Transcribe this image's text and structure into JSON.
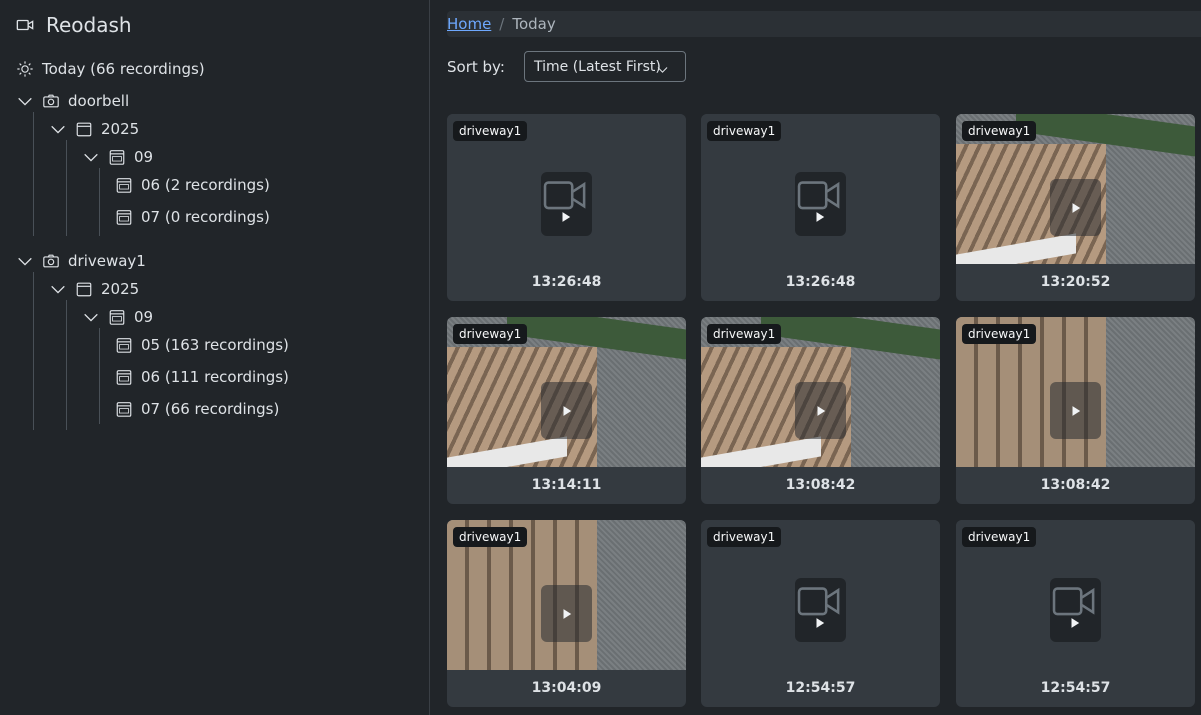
{
  "app": {
    "title": "Reodash"
  },
  "sidebar": {
    "today": "Today (66 recordings)",
    "cameras": [
      {
        "name": "doorbell",
        "year": "2025",
        "month": "09",
        "days": [
          "06 (2 recordings)",
          "07 (0 recordings)"
        ]
      },
      {
        "name": "driveway1",
        "year": "2025",
        "month": "09",
        "days": [
          "05 (163 recordings)",
          "06 (111 recordings)",
          "07 (66 recordings)"
        ]
      }
    ]
  },
  "breadcrumb": {
    "home": "Home",
    "separator": "/",
    "current": "Today"
  },
  "sort": {
    "label": "Sort by:",
    "selected": "Time (Latest First)"
  },
  "recordings": [
    {
      "camera": "driveway1",
      "time": "13:26:48",
      "thumbnail": false
    },
    {
      "camera": "driveway1",
      "time": "13:26:48",
      "thumbnail": false
    },
    {
      "camera": "driveway1",
      "time": "13:20:52",
      "thumbnail": true
    },
    {
      "camera": "driveway1",
      "time": "13:14:11",
      "thumbnail": true
    },
    {
      "camera": "driveway1",
      "time": "13:08:42",
      "thumbnail": true
    },
    {
      "camera": "driveway1",
      "time": "13:08:42",
      "thumbnail": true
    },
    {
      "camera": "driveway1",
      "time": "13:04:09",
      "thumbnail": true
    },
    {
      "camera": "driveway1",
      "time": "12:54:57",
      "thumbnail": false
    },
    {
      "camera": "driveway1",
      "time": "12:54:57",
      "thumbnail": false
    }
  ],
  "colors": {
    "accent_link": "#6ea8fe",
    "background": "#212529",
    "card": "#343a40"
  }
}
